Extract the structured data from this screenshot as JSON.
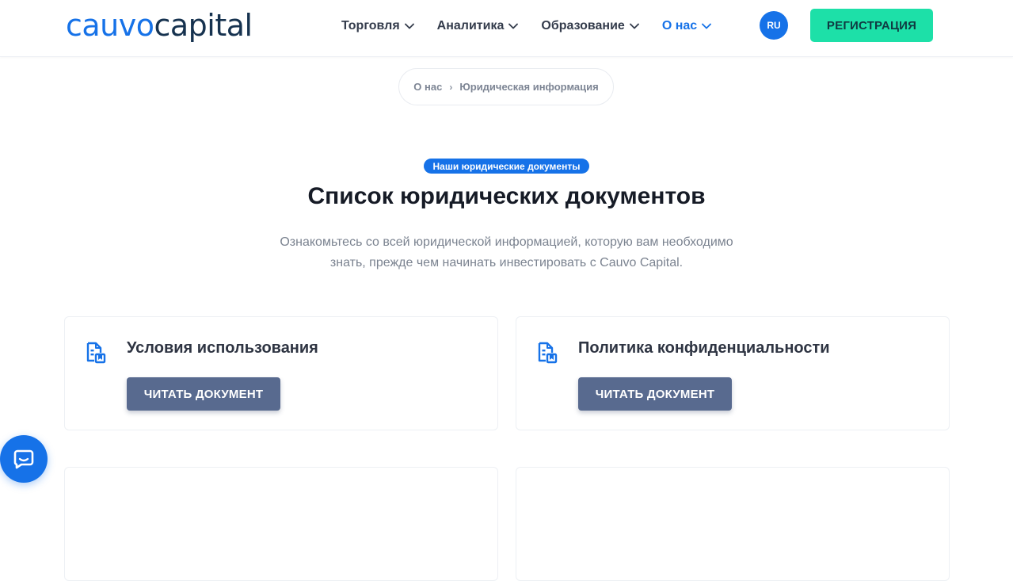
{
  "logo": {
    "part1": "cauvo",
    "part2": "capital"
  },
  "nav": {
    "items": [
      {
        "label": "Торговля",
        "active": false
      },
      {
        "label": "Аналитика",
        "active": false
      },
      {
        "label": "Образование",
        "active": false
      },
      {
        "label": "О нас",
        "active": true
      }
    ]
  },
  "lang": {
    "label": "RU"
  },
  "register": {
    "label": "РЕГИСТРАЦИЯ"
  },
  "breadcrumb": {
    "item1": "О нас",
    "item2": "Юридическая информация",
    "separator": "›"
  },
  "hero": {
    "tag": "Наши юридические документы",
    "title": "Список юридических документов",
    "subtitle_line1": "Ознакомьтесь со всей юридической информацией, которую вам необходимо",
    "subtitle_line2": "знать, прежде чем начинать инвестировать с Cauvo Capital."
  },
  "cards": [
    {
      "title": "Условия использования",
      "button": "ЧИТАТЬ ДОКУМЕНТ",
      "icon": "document-icon"
    },
    {
      "title": "Политика конфиденциальности",
      "button": "ЧИТАТЬ ДОКУМЕНТ",
      "icon": "document-icon"
    },
    {
      "title": "",
      "button": "",
      "icon": ""
    },
    {
      "title": "",
      "button": "",
      "icon": ""
    }
  ],
  "colors": {
    "brand_blue": "#1672e8",
    "brand_dark": "#16324f",
    "register_green": "#1de0a8",
    "button_slate": "#586a8f"
  },
  "chat": {
    "icon": "chat-bubble-icon"
  }
}
